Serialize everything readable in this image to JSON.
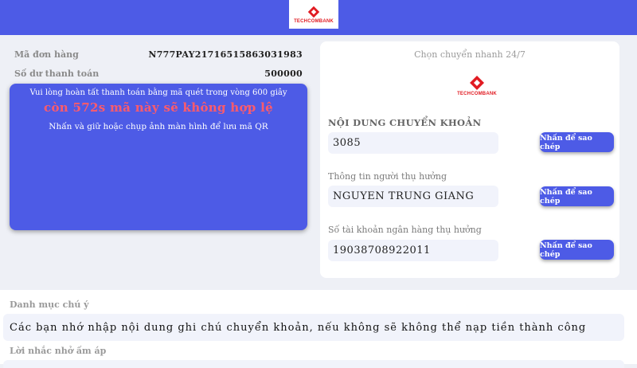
{
  "header": {
    "logo_text": "TECHCOMBANK",
    "logo_icon": "techcombank-logo-icon"
  },
  "order": {
    "order_label": "Mã đơn hàng",
    "order_value": "N777PAY21716515863031983",
    "balance_label": "Số dư thanh toán",
    "balance_value": "500000"
  },
  "qr": {
    "notice": "Vui lòng hoàn tất thanh toán bằng mã quét trong vòng 600 giây",
    "countdown": "còn 572s mã này sẽ không hợp lệ",
    "hint": "Nhấn và giữ hoặc chụp ảnh màn hình để lưu mã QR"
  },
  "transfer": {
    "heading": "Chọn chuyển nhanh 24/7",
    "logo_text": "TECHCOMBANK",
    "content_label": "NỘI DUNG CHUYỂN KHOẢN",
    "content_value": "3085",
    "beneficiary_label": "Thông tin người thụ hưởng",
    "beneficiary_value": "NGUYEN TRUNG GIANG",
    "account_label": "Số tài khoản ngân hàng thụ hưởng",
    "account_value": "19038708922011",
    "copy_label": "Nhấn để sao chép"
  },
  "notes": {
    "title": "Danh mục chú ý",
    "text": "Các bạn nhớ nhập nội dung ghi chú chuyển khoản, nếu không sẽ không thể nạp tiền thành công",
    "reminder_title": "Lời nhắc nhở ấm áp"
  },
  "colors": {
    "accent": "#4d5be6",
    "brand_red": "#e11b22",
    "countdown": "#ff5b6b"
  }
}
